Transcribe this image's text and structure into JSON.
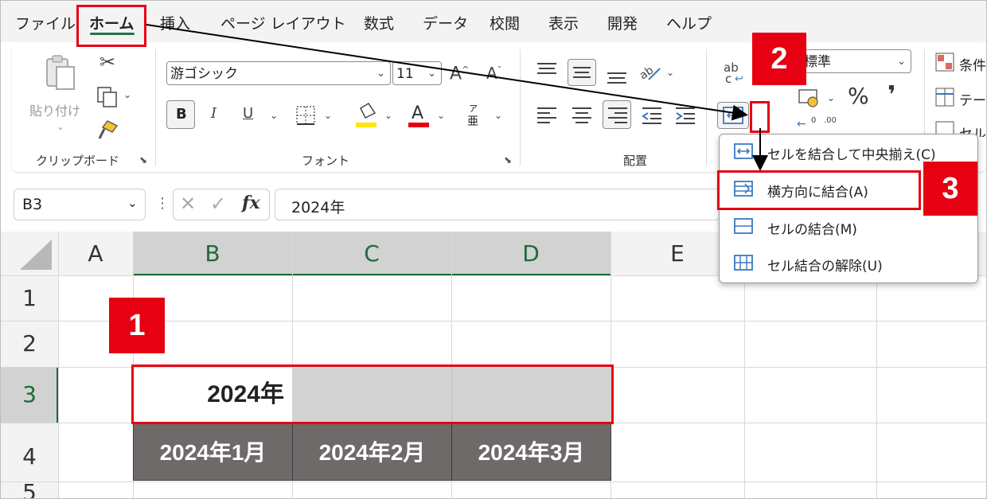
{
  "menu": {
    "tabs": [
      "ファイル",
      "ホーム",
      "挿入",
      "ページ レイアウト",
      "数式",
      "データ",
      "校閲",
      "表示",
      "開発",
      "ヘルプ"
    ],
    "active_tab": "ホーム"
  },
  "ribbon": {
    "clipboard": {
      "paste_label": "貼り付け",
      "group_label": "クリップボード"
    },
    "font": {
      "font_name": "游ゴシック",
      "font_size": "11",
      "bold": "B",
      "italic": "I",
      "underline": "U",
      "font_color_glyph": "A",
      "phonetic_top": "ア",
      "phonetic_bottom": "亜",
      "group_label": "フォント"
    },
    "alignment": {
      "group_label": "配置",
      "wrap_glyph_top": "ab",
      "wrap_glyph_bottom": "c"
    },
    "number": {
      "format": "標準",
      "percent": "%",
      "comma": "❜",
      "decimal_inc": ".00"
    },
    "styles": {
      "conditional": "条件",
      "table": "テー",
      "cell": "セル"
    }
  },
  "formula_bar": {
    "name_box": "B3",
    "fx": "fx",
    "content": "2024年"
  },
  "grid": {
    "columns": [
      "A",
      "B",
      "C",
      "D",
      "E"
    ],
    "rows": [
      "1",
      "2",
      "3",
      "4",
      "5"
    ],
    "cells": {
      "B3": "2024年",
      "B4": "2024年1月",
      "C4": "2024年2月",
      "D4": "2024年3月"
    }
  },
  "merge_menu": {
    "items": [
      {
        "label": "セルを結合して中央揃え(C)"
      },
      {
        "label": "横方向に結合(A)"
      },
      {
        "label": "セルの結合(M)"
      },
      {
        "label": "セル結合の解除(U)"
      }
    ]
  },
  "callouts": [
    "1",
    "2",
    "3"
  ],
  "colors": {
    "callout_red": "#e60012",
    "excel_green": "#217346",
    "header_dark": "#6e6a69",
    "selection_gray": "#d2d2d2"
  }
}
